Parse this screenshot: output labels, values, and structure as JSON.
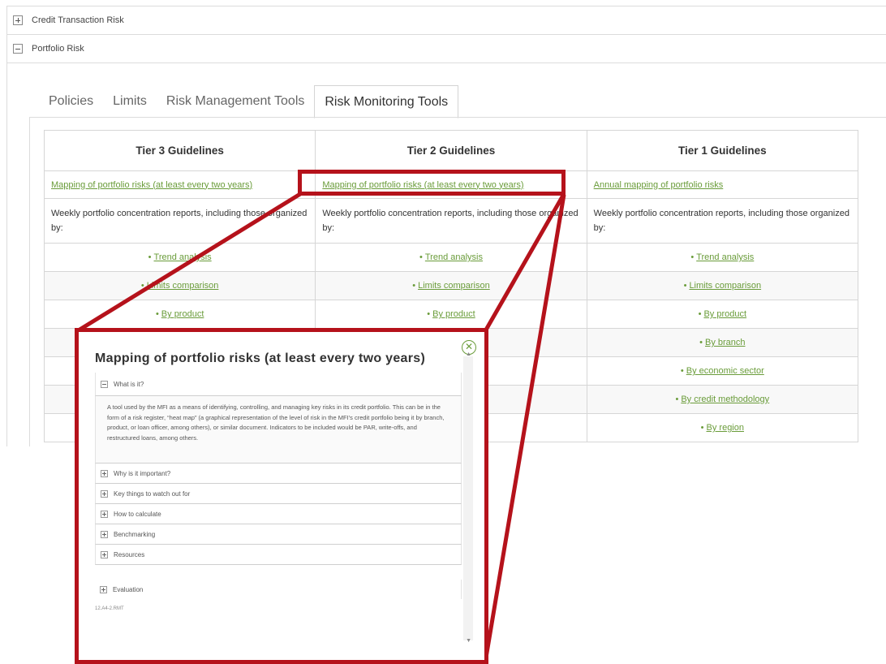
{
  "accordion": {
    "credit_label": "Credit Transaction Risk",
    "portfolio_label": "Portfolio Risk"
  },
  "tabs": [
    {
      "label": "Policies"
    },
    {
      "label": "Limits"
    },
    {
      "label": "Risk Management Tools"
    },
    {
      "label": "Risk Monitoring Tools"
    }
  ],
  "table": {
    "headers": [
      "Tier 3 Guidelines",
      "Tier 2 Guidelines",
      "Tier 1 Guidelines"
    ],
    "link_row": [
      "Mapping of portfolio risks (at least every two years)",
      "Mapping of portfolio risks (at least every two years)",
      "Annual mapping of portfolio risks"
    ],
    "text_row": [
      "Weekly portfolio concentration reports, including those organized by:",
      "Weekly portfolio concentration reports, including those organized by:",
      "Weekly portfolio concentration reports, including those organized by:"
    ],
    "bullets": [
      [
        "Trend analysis",
        "Trend analysis",
        "Trend analysis"
      ],
      [
        "Limits comparison",
        "Limits comparison",
        "Limits comparison"
      ],
      [
        "By product",
        "By product",
        "By product"
      ],
      [
        "",
        "",
        "By branch"
      ],
      [
        "",
        "",
        "By economic sector"
      ],
      [
        "",
        "",
        "By credit methodology"
      ],
      [
        "",
        "",
        "By region"
      ]
    ]
  },
  "modal": {
    "title": "Mapping of portfolio risks (at least every two years)",
    "close_glyph": "✕",
    "what_label": "What is it?",
    "description": "A tool used by the MFI as a means of identifying, controlling, and managing key risks in its credit portfolio. This can be in the form of a risk register, “heat map” (a graphical representation of the level of risk in the MFI’s credit portfolio being it by branch, product, or loan officer, among others), or similar document. Indicators to be included would be PAR, write-offs, and restructured loans, among others.",
    "sections": [
      "Why is it important?",
      "Key things to watch out for",
      "How to calculate",
      "Benchmarking",
      "Resources"
    ],
    "evaluation_label": "Evaluation",
    "code": "12.A4-2.RMT"
  },
  "colors": {
    "link_green": "#6a9c3a",
    "callout_red": "#b5121b"
  }
}
